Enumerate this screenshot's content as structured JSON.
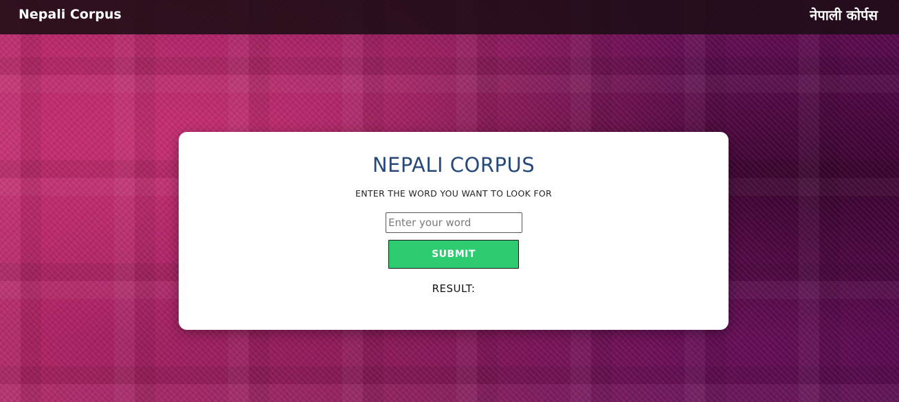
{
  "header": {
    "brand_left": "Nepali Corpus",
    "brand_right": "नेपाली कोर्पस"
  },
  "card": {
    "title": "NEPALI CORPUS",
    "subtitle": "ENTER THE WORD YOU WANT TO LOOK FOR",
    "input": {
      "placeholder": "Enter your word",
      "value": ""
    },
    "submit_label": "SUBMIT",
    "result_label": "RESULT:"
  },
  "colors": {
    "header_bg": "#1c0c14",
    "title": "#26497a",
    "submit_bg": "#2ecc71",
    "background_accent": "#8a1a5a"
  }
}
